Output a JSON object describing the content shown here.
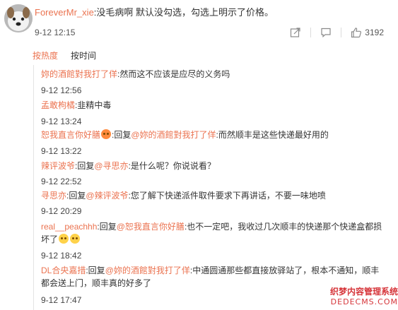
{
  "main_comment": {
    "username": "ForeverMr_xie",
    "text": ":没毛病啊 默认没勾选，勾选上明示了价格。",
    "time": "9-12 12:15",
    "like_count": "3192"
  },
  "sort_tabs": [
    "按热度",
    "按时间"
  ],
  "replies": [
    {
      "user": "妳的酒館對我打了佯",
      "body": ":然而这不应该是应尽的义务吗",
      "time": "9-12 12:56"
    },
    {
      "user": "孟敢枸橘",
      "body": ":韭精中毒",
      "time": "9-12 13:24"
    },
    {
      "user": "恕我直言你好膳",
      "emoji": "angry-face",
      "prefix": ":回复",
      "reply_to": "@妳的酒館對我打了佯",
      "body": ":而然顺丰是这些快递最好用的",
      "time": "9-12 13:22"
    },
    {
      "user": "辣评波爷",
      "prefix": ":回复",
      "reply_to": "@寻思亦",
      "body": ":是什么呢？你说说看？",
      "time": "9-12 22:52"
    },
    {
      "user": "寻思亦",
      "prefix": ":回复",
      "reply_to": "@辣评波爷",
      "body": ":您了解下快递派件取件要求下再讲话，不要一味地喷",
      "time": "9-12 20:29"
    },
    {
      "user": "real__peachhh",
      "prefix": ":回复",
      "reply_to": "@恕我直言你好膳",
      "body": ":也不一定吧，我收过几次顺丰的快递那个快递盒都损",
      "body2": "坏了",
      "emoji": "crying-face",
      "time": "9-12 18:42"
    },
    {
      "user": "DL合央嘉措",
      "prefix": ":回复",
      "reply_to": "@妳的酒館對我打了佯",
      "body": ":中通圆通那些都直接放驿站了，根本不通知，顺丰",
      "body2": "都会送上门，顺丰真的好多了",
      "time": "9-12 17:47"
    }
  ],
  "watermark": {
    "line1": "织梦内容管理系统",
    "line2": "DEDECMS.COM"
  },
  "colors": {
    "accent": "#eb7350",
    "text": "#333333",
    "muted": "#8a8a8a"
  }
}
